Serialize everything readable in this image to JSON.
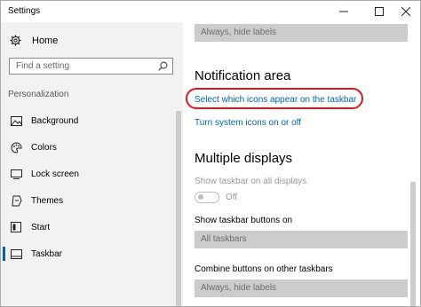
{
  "window": {
    "title": "Settings"
  },
  "sidebar": {
    "home_label": "Home",
    "search": {
      "placeholder": "Find a setting"
    },
    "section_label": "Personalization",
    "items": [
      {
        "label": "Background",
        "icon": "image-icon"
      },
      {
        "label": "Colors",
        "icon": "palette-icon"
      },
      {
        "label": "Lock screen",
        "icon": "lock-screen-icon"
      },
      {
        "label": "Themes",
        "icon": "themes-icon"
      },
      {
        "label": "Start",
        "icon": "start-icon"
      },
      {
        "label": "Taskbar",
        "icon": "taskbar-icon",
        "selected": true
      }
    ]
  },
  "content": {
    "top_dropdown_value": "Always, hide labels",
    "notification_area": {
      "heading": "Notification area",
      "link_select_icons": "Select which icons appear on the taskbar",
      "link_system_icons": "Turn system icons on or off"
    },
    "multiple_displays": {
      "heading": "Multiple displays",
      "show_taskbar_all_label": "Show taskbar on all displays",
      "toggle_state": "Off",
      "show_buttons_label": "Show taskbar buttons on",
      "show_buttons_value": "All taskbars",
      "combine_label": "Combine buttons on other taskbars",
      "combine_value": "Always, hide labels"
    }
  },
  "colors": {
    "accent": "#0063b1",
    "annotation_circle": "#e0161e"
  }
}
